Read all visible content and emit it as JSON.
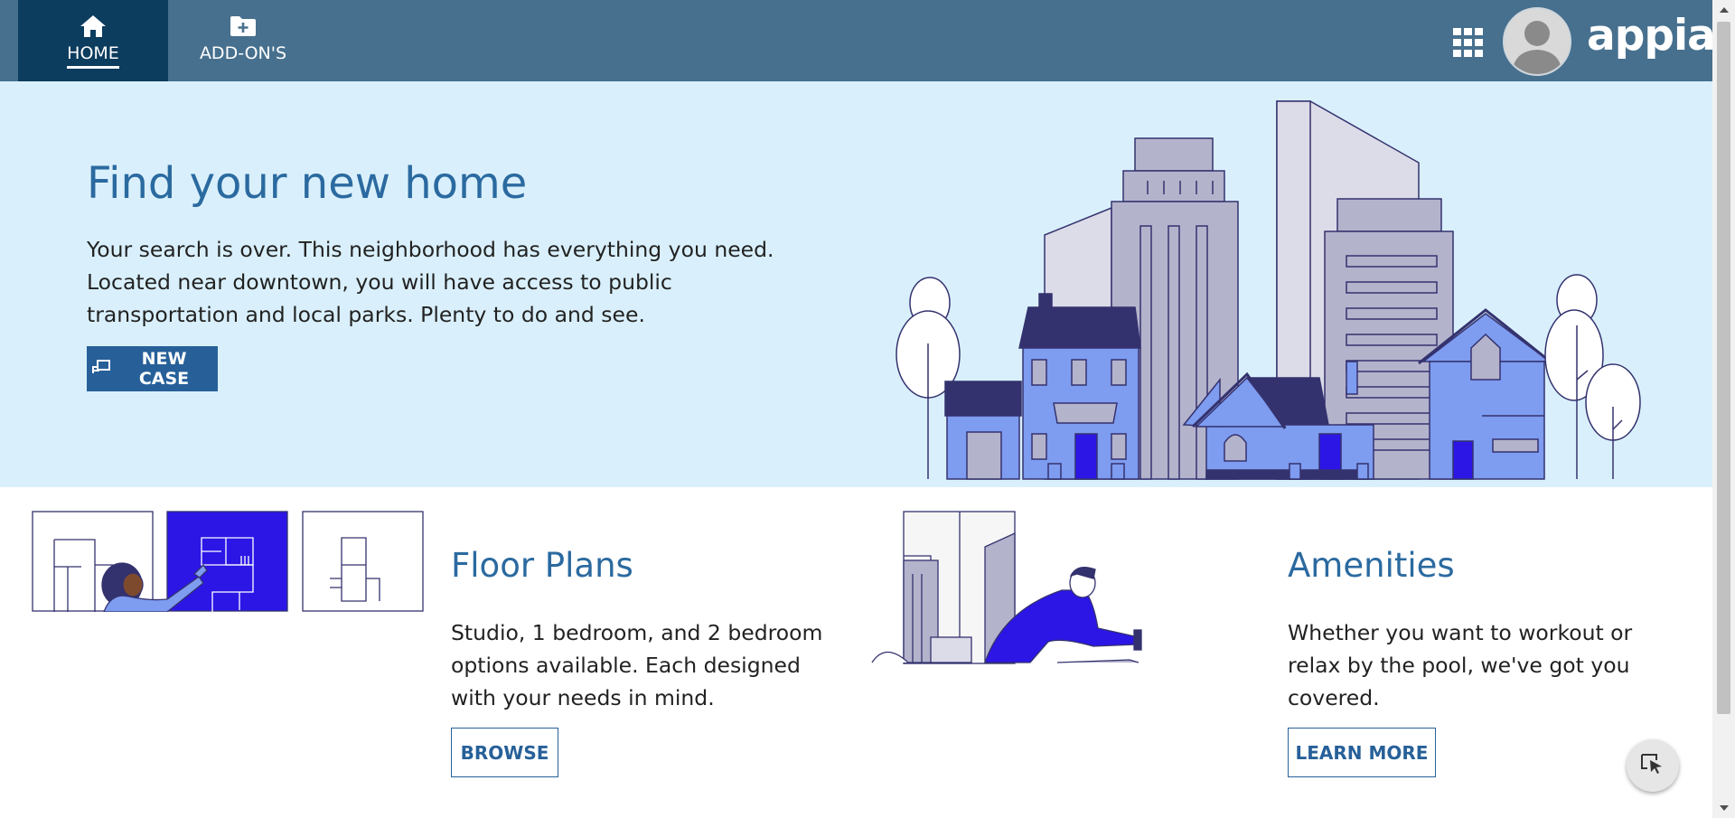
{
  "nav": {
    "tabs": [
      {
        "label": "HOME",
        "icon": "home-icon",
        "active": true
      },
      {
        "label": "ADD-ON'S",
        "icon": "folder-plus-icon",
        "active": false
      }
    ],
    "apps_icon": "grid-icon",
    "brand": "appian"
  },
  "hero": {
    "title": "Find your new home",
    "text": "Your search is over. This neighborhood has everything you need. Located near downtown, you will have access to public transportation and local parks. Plenty to do and see.",
    "button_label": "NEW CASE",
    "button_icon": "new-case-icon"
  },
  "floor_plans": {
    "title": "Floor Plans",
    "text": "Studio, 1 bedroom, and 2 bedroom options available. Each designed with your needs in mind.",
    "button_label": "BROWSE"
  },
  "amenities": {
    "title": "Amenities",
    "text": "Whether you want to workout or relax by the pool, we've got you covered.",
    "button_label": "LEARN MORE"
  },
  "colors": {
    "topbar": "#47708e",
    "active_tab": "#0c3c5e",
    "hero_bg": "#d9f0fc",
    "heading": "#2b6aa0",
    "primary_button": "#276099",
    "illustration_blue": "#2b16e6",
    "illustration_light_blue": "#7e9cf0",
    "illustration_navy": "#34326e",
    "illustration_gray": "#b4b3cc"
  }
}
